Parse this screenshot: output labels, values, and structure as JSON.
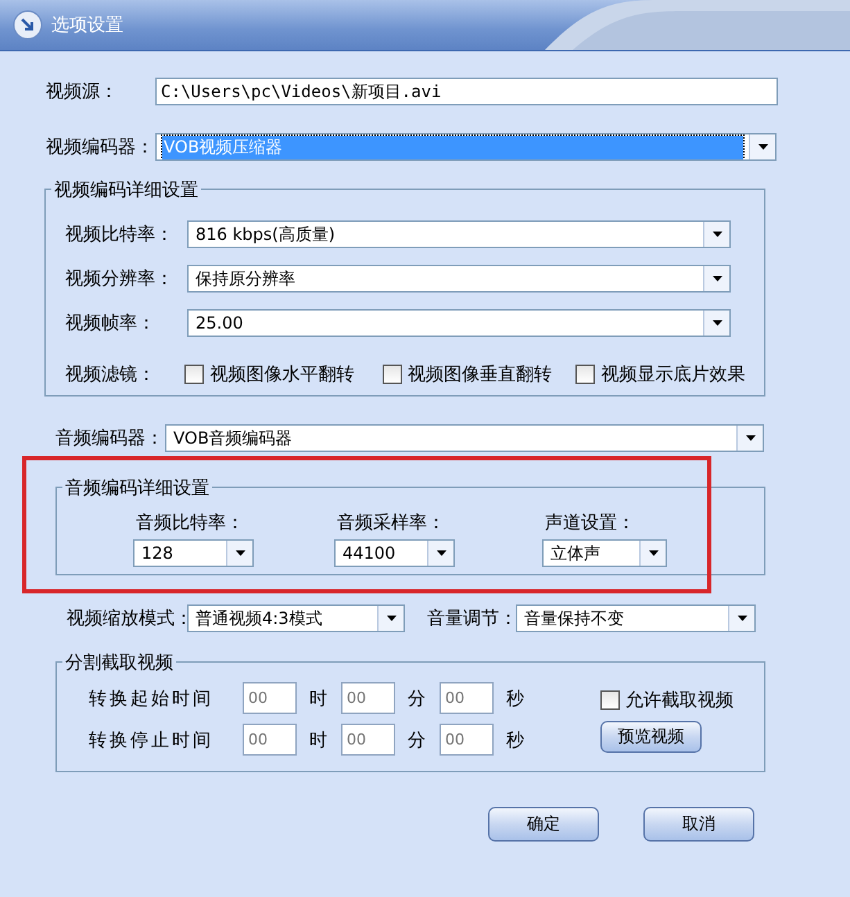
{
  "window": {
    "title": "选项设置"
  },
  "video_source": {
    "label": "视频源：",
    "value": "C:\\Users\\pc\\Videos\\新项目.avi"
  },
  "video_encoder": {
    "label": "视频编码器：",
    "value": "VOB视频压缩器",
    "focused": true
  },
  "video_detail": {
    "title": "视频编码详细设置",
    "fields": [
      {
        "label": "视频比特率：",
        "value": "816 kbps(高质量)"
      },
      {
        "label": "视频分辨率：",
        "value": "保持原分辨率"
      },
      {
        "label": "视频帧率：",
        "value": "25.00"
      }
    ],
    "filter": {
      "label": "视频滤镜：",
      "options": [
        {
          "label": "视频图像水平翻转",
          "checked": false
        },
        {
          "label": "视频图像垂直翻转",
          "checked": false
        },
        {
          "label": "视频显示底片效果",
          "checked": false
        }
      ]
    }
  },
  "audio_encoder": {
    "label": "音频编码器：",
    "value": "VOB音频编码器",
    "focused": false
  },
  "audio_detail": {
    "title": "音频编码详细设置",
    "highlighted": true,
    "fields": [
      {
        "label": "音频比特率：",
        "value": "128"
      },
      {
        "label": "音频采样率：",
        "value": "44100"
      },
      {
        "label": "声道设置：",
        "value": "立体声"
      }
    ]
  },
  "scale_mode": {
    "label": "视频缩放模式：",
    "value": "普通视频4:3模式"
  },
  "volume": {
    "label": "音量调节：",
    "value": "音量保持不变"
  },
  "split": {
    "title": "分割截取视频",
    "rows": [
      {
        "label": "转换起始时间",
        "parts": [
          {
            "placeholder": "00",
            "unit": "时"
          },
          {
            "placeholder": "00",
            "unit": "分"
          },
          {
            "placeholder": "00",
            "unit": "秒"
          }
        ]
      },
      {
        "label": "转换停止时间",
        "parts": [
          {
            "placeholder": "00",
            "unit": "时"
          },
          {
            "placeholder": "00",
            "unit": "分"
          },
          {
            "placeholder": "00",
            "unit": "秒"
          }
        ]
      }
    ],
    "allow": {
      "label": "允许截取视频",
      "checked": false
    },
    "preview_button": "预览视频"
  },
  "buttons": [
    "确定",
    "取消"
  ]
}
